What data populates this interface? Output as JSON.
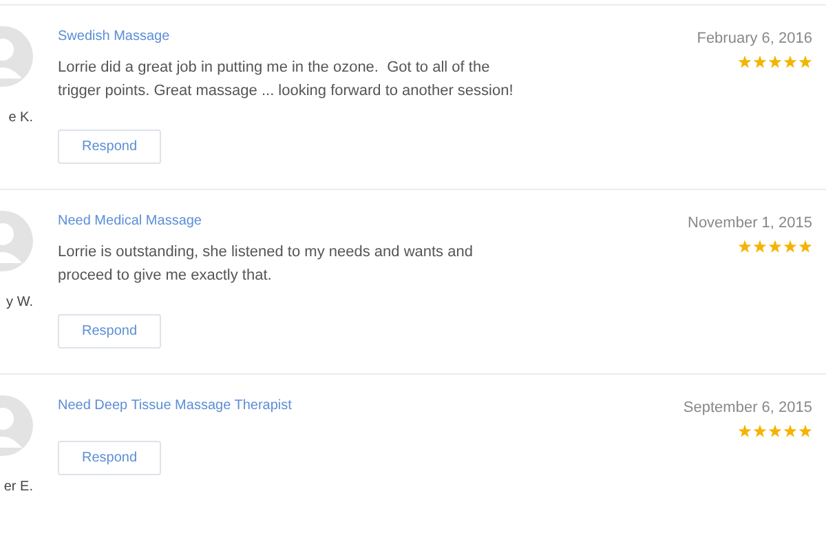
{
  "reviews": [
    {
      "reviewer": "e K.",
      "title": "Swedish Massage",
      "text": "Lorrie did a great job in putting me in the ozone.  Got to all of the trigger points. Great massage ... looking forward to another session!",
      "date": "February 6, 2016",
      "stars": 5,
      "button": "Respond"
    },
    {
      "reviewer": "y W.",
      "title": "Need Medical Massage",
      "text": "Lorrie is outstanding, she listened to my needs and wants and proceed to give me exactly that.",
      "date": "November 1, 2015",
      "stars": 5,
      "button": "Respond"
    },
    {
      "reviewer": "er E.",
      "title": "Need Deep Tissue Massage Therapist",
      "date": "September 6, 2015",
      "stars": 5,
      "button": "Respond"
    }
  ]
}
